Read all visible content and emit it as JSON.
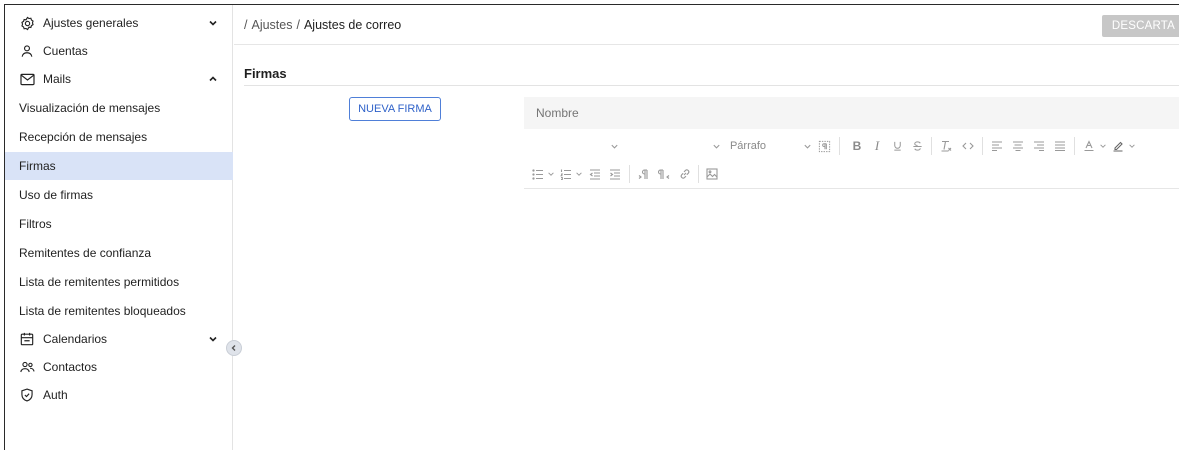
{
  "sidebar": {
    "items": [
      {
        "label": "Ajustes generales",
        "icon": "gear-icon",
        "chevron": "down"
      },
      {
        "label": "Cuentas",
        "icon": "user-icon"
      },
      {
        "label": "Mails",
        "icon": "mail-icon",
        "chevron": "up"
      },
      {
        "label": "Visualización de mensajes"
      },
      {
        "label": "Recepción de mensajes"
      },
      {
        "label": "Firmas",
        "active": true
      },
      {
        "label": "Uso de firmas"
      },
      {
        "label": "Filtros"
      },
      {
        "label": "Remitentes de confianza"
      },
      {
        "label": "Lista de remitentes permitidos"
      },
      {
        "label": "Lista de remitentes bloqueados"
      },
      {
        "label": "Calendarios",
        "icon": "calendar-icon",
        "chevron": "down"
      },
      {
        "label": "Contactos",
        "icon": "contacts-icon"
      },
      {
        "label": "Auth",
        "icon": "shield-icon"
      }
    ]
  },
  "breadcrumb": {
    "separator": "/",
    "parent": "Ajustes",
    "current": "Ajustes de correo"
  },
  "header": {
    "discard_label": "DESCARTA"
  },
  "section": {
    "title": "Firmas"
  },
  "actions": {
    "new_signature": "NUEVA FIRMA"
  },
  "form": {
    "name_placeholder": "Nombre"
  },
  "editor": {
    "paragraph_format": "Párrafo"
  },
  "colors": {
    "active_bg": "#d9e3f7",
    "accent": "#2f62c9",
    "discard_bg": "#c7c7c7"
  }
}
